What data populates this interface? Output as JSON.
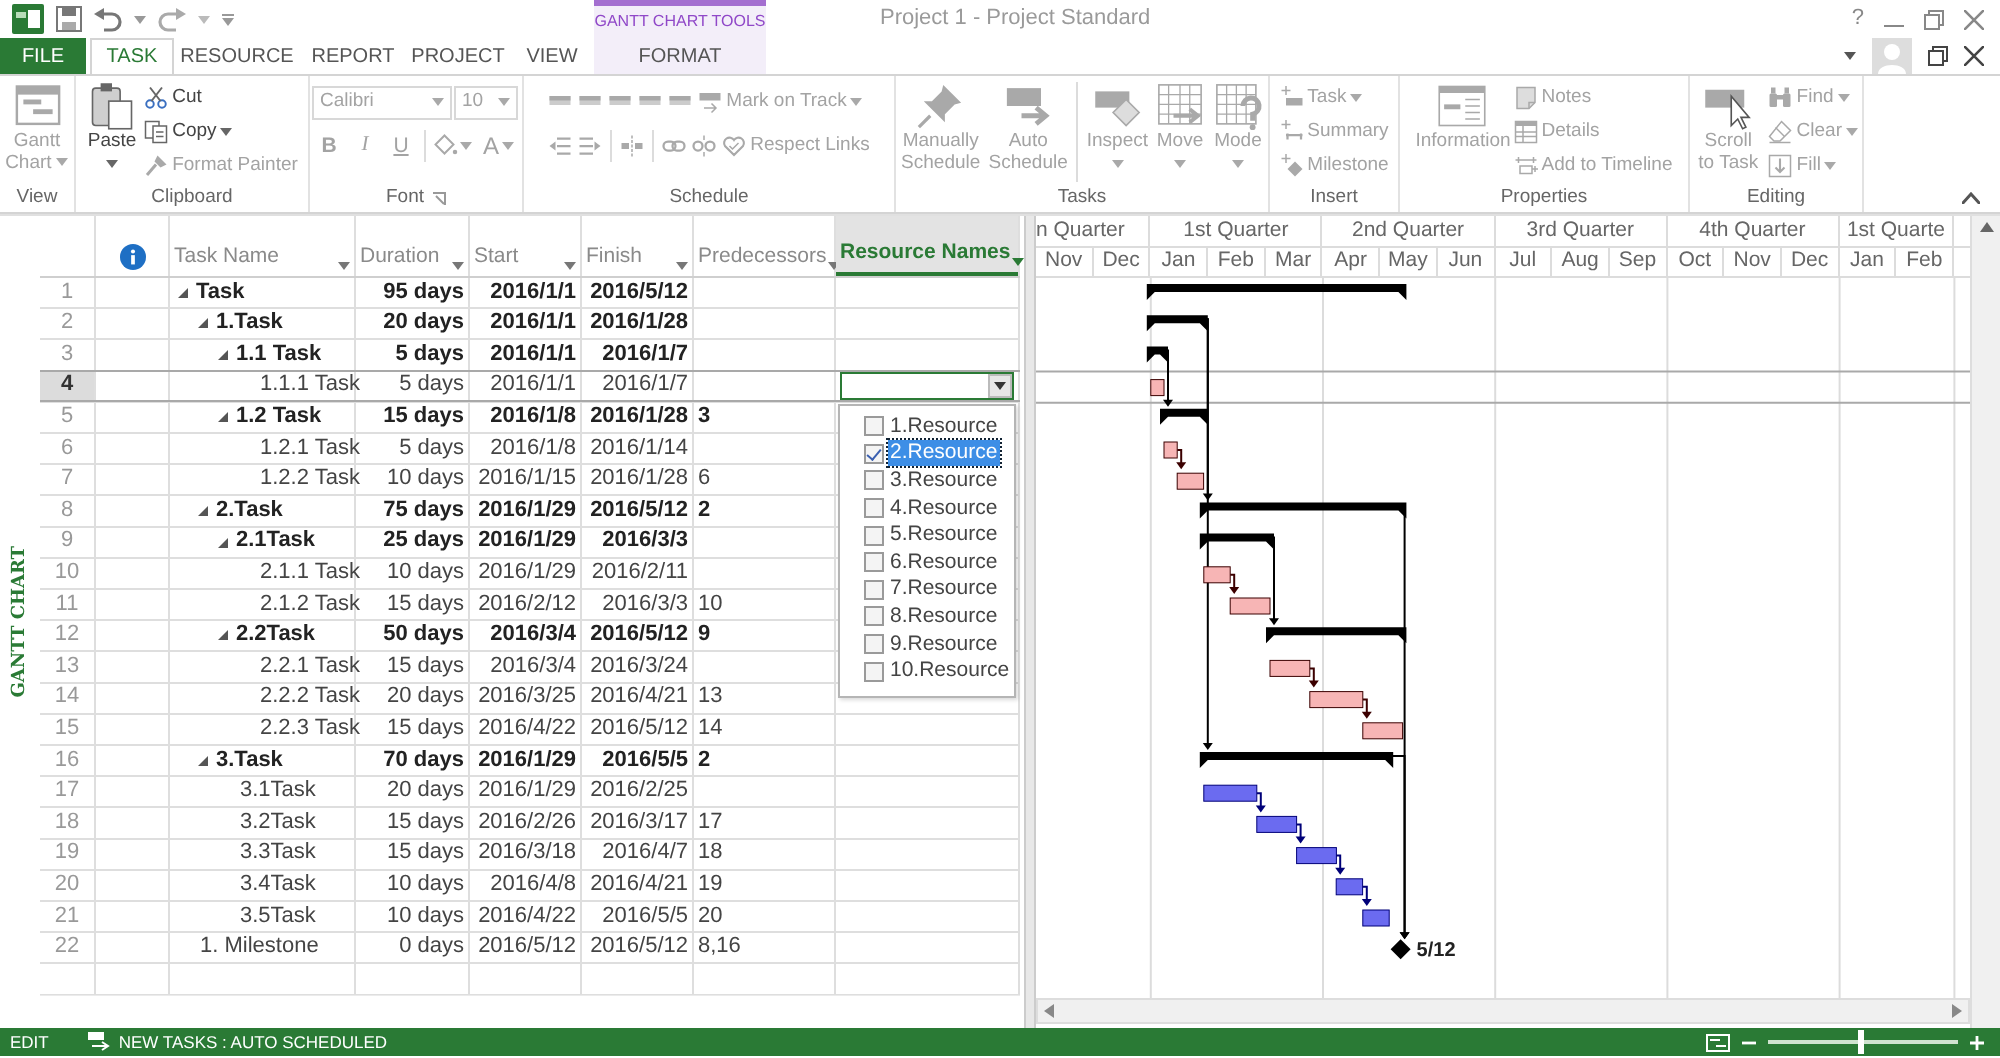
{
  "window": {
    "title": "Project 1 - Project Standard",
    "help": "?",
    "contextual_group": "GANTT CHART TOOLS"
  },
  "ribbon_tabs": [
    {
      "label": "FILE",
      "kind": "file",
      "selected": false
    },
    {
      "label": "TASK",
      "kind": "tab",
      "selected": true
    },
    {
      "label": "RESOURCE",
      "kind": "tab",
      "selected": false
    },
    {
      "label": "REPORT",
      "kind": "tab",
      "selected": false
    },
    {
      "label": "PROJECT",
      "kind": "tab",
      "selected": false
    },
    {
      "label": "VIEW",
      "kind": "tab",
      "selected": false
    },
    {
      "label": "FORMAT",
      "kind": "contextual",
      "selected": false
    }
  ],
  "ribbon_groups": [
    {
      "label": "View",
      "controls": [
        {
          "kind": "large",
          "label": "Gantt Chart",
          "dropdown": true,
          "disabled": true
        }
      ]
    },
    {
      "label": "Clipboard",
      "controls": [
        {
          "kind": "large",
          "label": "Paste",
          "dropdown": true,
          "disabled": false
        },
        {
          "kind": "small",
          "label": "Cut",
          "disabled": false
        },
        {
          "kind": "small",
          "label": "Copy",
          "dropdown": true,
          "disabled": false
        },
        {
          "kind": "small",
          "label": "Format Painter",
          "disabled": true
        }
      ]
    },
    {
      "label": "Font",
      "launcher": true,
      "lines": [
        {
          "controls": [
            {
              "kind": "combo",
              "label": "Calibri",
              "disabled": true
            },
            {
              "kind": "combo",
              "label": "10",
              "disabled": true
            }
          ]
        },
        {
          "controls": [
            {
              "kind": "glyph",
              "label": "B",
              "disabled": true
            },
            {
              "kind": "glyph",
              "label": "I",
              "disabled": true
            },
            {
              "kind": "glyph",
              "label": "U",
              "disabled": true
            },
            {
              "kind": "separator"
            },
            {
              "kind": "icon",
              "dropdown": true,
              "disabled": true
            },
            {
              "kind": "glyph",
              "label": "A",
              "dropdown": true,
              "disabled": true
            }
          ]
        }
      ]
    },
    {
      "label": "Schedule",
      "lines": [
        {
          "controls": [
            {
              "kind": "icon",
              "disabled": true
            },
            {
              "kind": "icon",
              "disabled": true
            },
            {
              "kind": "icon",
              "disabled": true
            },
            {
              "kind": "icon",
              "disabled": true
            },
            {
              "kind": "icon",
              "disabled": true
            },
            {
              "kind": "small",
              "label": "Mark on Track",
              "dropdown": true,
              "disabled": true
            }
          ]
        },
        {
          "controls": [
            {
              "kind": "icon",
              "disabled": true
            },
            {
              "kind": "icon",
              "disabled": true
            },
            {
              "kind": "separator"
            },
            {
              "kind": "icon",
              "disabled": true
            },
            {
              "kind": "separator"
            },
            {
              "kind": "icon",
              "disabled": true
            },
            {
              "kind": "icon",
              "disabled": true
            },
            {
              "kind": "small",
              "label": "Respect Links",
              "disabled": true
            }
          ]
        }
      ]
    },
    {
      "label": "Tasks",
      "controls": [
        {
          "kind": "large",
          "label": "Manually Schedule",
          "disabled": true
        },
        {
          "kind": "large",
          "label": "Auto Schedule",
          "disabled": true
        },
        {
          "kind": "separator"
        },
        {
          "kind": "large",
          "label": "Inspect",
          "dropdown": true,
          "disabled": true
        },
        {
          "kind": "large",
          "label": "Move",
          "dropdown": true,
          "disabled": true
        },
        {
          "kind": "large",
          "label": "Mode",
          "dropdown": true,
          "disabled": true
        }
      ]
    },
    {
      "label": "Insert",
      "controls": [
        {
          "kind": "small",
          "label": "Task",
          "dropdown": true,
          "disabled": true
        },
        {
          "kind": "small",
          "label": "Summary",
          "disabled": true
        },
        {
          "kind": "small",
          "label": "Milestone",
          "disabled": true
        }
      ]
    },
    {
      "label": "Properties",
      "controls": [
        {
          "kind": "large",
          "label": "Information",
          "disabled": true
        },
        {
          "kind": "small",
          "label": "Notes",
          "disabled": true
        },
        {
          "kind": "small",
          "label": "Details",
          "disabled": true
        },
        {
          "kind": "small",
          "label": "Add to Timeline",
          "disabled": true
        }
      ]
    },
    {
      "label": "Editing",
      "controls": [
        {
          "kind": "large",
          "label": "Scroll to Task",
          "disabled": true
        },
        {
          "kind": "small",
          "label": "Find",
          "dropdown": true,
          "disabled": true
        },
        {
          "kind": "small",
          "label": "Clear",
          "dropdown": true,
          "disabled": true
        },
        {
          "kind": "small",
          "label": "Fill",
          "dropdown": true,
          "disabled": true
        }
      ]
    }
  ],
  "view_bar": {
    "label": "GANTT CHART"
  },
  "table": {
    "columns": [
      {
        "label": "Task Name",
        "selected": false
      },
      {
        "label": "Duration",
        "selected": false
      },
      {
        "label": "Start",
        "selected": false
      },
      {
        "label": "Finish",
        "selected": false
      },
      {
        "label": "Predecessors",
        "selected": false
      },
      {
        "label": "Resource Names",
        "selected": true
      }
    ],
    "rows": [
      {
        "id": "1",
        "name": "Task",
        "duration": "95 days",
        "start": "2016/1/1",
        "finish": "2016/5/12",
        "kind": "summary",
        "expanded": true,
        "selected": false,
        "children": [
          {
            "id": "2",
            "name": "1.Task",
            "duration": "20 days",
            "start": "2016/1/1",
            "finish": "2016/1/28",
            "kind": "summary",
            "expanded": true,
            "selected": false,
            "children": [
              {
                "id": "3",
                "name": "1.1 Task",
                "duration": "5 days",
                "start": "2016/1/1",
                "finish": "2016/1/7",
                "kind": "summary",
                "expanded": true,
                "selected": false,
                "children": [
                  {
                    "id": "4",
                    "name": "1.1.1 Task",
                    "duration": "5 days",
                    "start": "2016/1/1",
                    "finish": "2016/1/7",
                    "kind": "task",
                    "color": "#f7b5b5",
                    "selected": true
                  }
                ]
              },
              {
                "id": "5",
                "name": "1.2 Task",
                "duration": "15 days",
                "start": "2016/1/8",
                "finish": "2016/1/28",
                "predecessors": "3",
                "kind": "summary",
                "expanded": true,
                "selected": false,
                "children": [
                  {
                    "id": "6",
                    "name": "1.2.1 Task",
                    "duration": "5 days",
                    "start": "2016/1/8",
                    "finish": "2016/1/14",
                    "kind": "task",
                    "color": "#f7b5b5",
                    "selected": false
                  },
                  {
                    "id": "7",
                    "name": "1.2.2 Task",
                    "duration": "10 days",
                    "start": "2016/1/15",
                    "finish": "2016/1/28",
                    "predecessors": "6",
                    "kind": "task",
                    "color": "#f7b5b5",
                    "selected": false
                  }
                ]
              }
            ]
          },
          {
            "id": "8",
            "name": "2.Task",
            "duration": "75 days",
            "start": "2016/1/29",
            "finish": "2016/5/12",
            "predecessors": "2",
            "kind": "summary",
            "expanded": true,
            "selected": false,
            "children": [
              {
                "id": "9",
                "name": "2.1Task",
                "duration": "25 days",
                "start": "2016/1/29",
                "finish": "2016/3/3",
                "kind": "summary",
                "expanded": true,
                "selected": false,
                "children": [
                  {
                    "id": "10",
                    "name": "2.1.1 Task",
                    "duration": "10 days",
                    "start": "2016/1/29",
                    "finish": "2016/2/11",
                    "kind": "task",
                    "color": "#f7b5b5",
                    "selected": false
                  },
                  {
                    "id": "11",
                    "name": "2.1.2 Task",
                    "duration": "15 days",
                    "start": "2016/2/12",
                    "finish": "2016/3/3",
                    "predecessors": "10",
                    "kind": "task",
                    "color": "#f7b5b5",
                    "selected": false
                  }
                ]
              },
              {
                "id": "12",
                "name": "2.2Task",
                "duration": "50 days",
                "start": "2016/3/4",
                "finish": "2016/5/12",
                "predecessors": "9",
                "kind": "summary",
                "expanded": true,
                "selected": false,
                "children": [
                  {
                    "id": "13",
                    "name": "2.2.1 Task",
                    "duration": "15 days",
                    "start": "2016/3/4",
                    "finish": "2016/3/24",
                    "kind": "task",
                    "color": "#f7b5b5",
                    "selected": false
                  },
                  {
                    "id": "14",
                    "name": "2.2.2 Task",
                    "duration": "20 days",
                    "start": "2016/3/25",
                    "finish": "2016/4/21",
                    "predecessors": "13",
                    "kind": "task",
                    "color": "#f7b5b5",
                    "selected": false
                  },
                  {
                    "id": "15",
                    "name": "2.2.3 Task",
                    "duration": "15 days",
                    "start": "2016/4/22",
                    "finish": "2016/5/12",
                    "predecessors": "14",
                    "kind": "task",
                    "color": "#f7b5b5",
                    "selected": false
                  }
                ]
              }
            ]
          },
          {
            "id": "16",
            "name": "3.Task",
            "duration": "70 days",
            "start": "2016/1/29",
            "finish": "2016/5/5",
            "predecessors": "2",
            "kind": "summary",
            "expanded": true,
            "selected": false,
            "children": [
              {
                "id": "17",
                "name": "3.1Task",
                "duration": "20 days",
                "start": "2016/1/29",
                "finish": "2016/2/25",
                "kind": "task",
                "color": "#6b6bf0",
                "selected": false
              },
              {
                "id": "18",
                "name": "3.2Task",
                "duration": "15 days",
                "start": "2016/2/26",
                "finish": "2016/3/17",
                "predecessors": "17",
                "kind": "task",
                "color": "#6b6bf0",
                "selected": false
              },
              {
                "id": "19",
                "name": "3.3Task",
                "duration": "15 days",
                "start": "2016/3/18",
                "finish": "2016/4/7",
                "predecessors": "18",
                "kind": "task",
                "color": "#6b6bf0",
                "selected": false
              },
              {
                "id": "20",
                "name": "3.4Task",
                "duration": "10 days",
                "start": "2016/4/8",
                "finish": "2016/4/21",
                "predecessors": "19",
                "kind": "task",
                "color": "#6b6bf0",
                "selected": false
              },
              {
                "id": "21",
                "name": "3.5Task",
                "duration": "10 days",
                "start": "2016/4/22",
                "finish": "2016/5/5",
                "predecessors": "20",
                "kind": "task",
                "color": "#6b6bf0",
                "selected": false
              }
            ]
          },
          {
            "id": "22",
            "name": "1. Milestone",
            "duration": "0 days",
            "start": "2016/5/12",
            "finish": "2016/5/12",
            "predecessors": "8,16",
            "kind": "milestone",
            "bar_label": "5/12",
            "selected": false
          }
        ]
      }
    ]
  },
  "resource_dropdown": {
    "options": [
      {
        "label": "1.Resource",
        "checked": false,
        "selected": false
      },
      {
        "label": "2.Resource",
        "checked": true,
        "selected": true
      },
      {
        "label": "3.Resource",
        "checked": false,
        "selected": false
      },
      {
        "label": "4.Resource",
        "checked": false,
        "selected": false
      },
      {
        "label": "5.Resource",
        "checked": false,
        "selected": false
      },
      {
        "label": "6.Resource",
        "checked": false,
        "selected": false
      },
      {
        "label": "7.Resource",
        "checked": false,
        "selected": false
      },
      {
        "label": "8.Resource",
        "checked": false,
        "selected": false
      },
      {
        "label": "9.Resource",
        "checked": false,
        "selected": false
      },
      {
        "label": "10.Resource",
        "checked": false,
        "selected": false
      }
    ]
  },
  "timescale": {
    "quarters": [
      {
        "label": "n Quarter",
        "months": [
          "Nov",
          "Dec"
        ]
      },
      {
        "label": "1st Quarter",
        "months": [
          "Jan",
          "Feb",
          "Mar"
        ]
      },
      {
        "label": "2nd Quarter",
        "months": [
          "Apr",
          "May",
          "Jun"
        ]
      },
      {
        "label": "3rd Quarter",
        "months": [
          "Jul",
          "Aug",
          "Sep"
        ]
      },
      {
        "label": "4th Quarter",
        "months": [
          "Oct",
          "Nov",
          "Dec"
        ]
      },
      {
        "label": "1st Quarte",
        "months": [
          "Jan",
          "Feb"
        ]
      }
    ]
  },
  "status_bar": {
    "mode": "EDIT",
    "new_tasks": "NEW TASKS : AUTO SCHEDULED",
    "zoom": {
      "level": 0.48
    }
  }
}
